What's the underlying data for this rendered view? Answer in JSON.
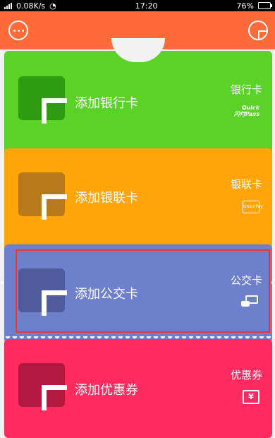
{
  "status_bar": {
    "speed": "0.08K/s",
    "time": "17:20",
    "battery": "76%",
    "battery_level": 0.76
  },
  "header": {
    "left_icon": "more-icon",
    "right_icon": "plus-icon"
  },
  "cards": [
    {
      "add_label": "添加银行卡",
      "type_label": "银行卡",
      "logo_text": "Quick\n闪付Pass",
      "color": "#5bd227"
    },
    {
      "add_label": "添加银联卡",
      "type_label": "银联卡",
      "logo_text": "UnionPay",
      "color": "#ffa50a"
    },
    {
      "add_label": "添加公交卡",
      "type_label": "公交卡",
      "logo_text": "",
      "color": "#6e7fcb"
    },
    {
      "add_label": "添加优惠券",
      "type_label": "优惠券",
      "logo_text": "¥",
      "color": "#ff2a5f"
    }
  ],
  "highlight_color": "#e23a3a"
}
